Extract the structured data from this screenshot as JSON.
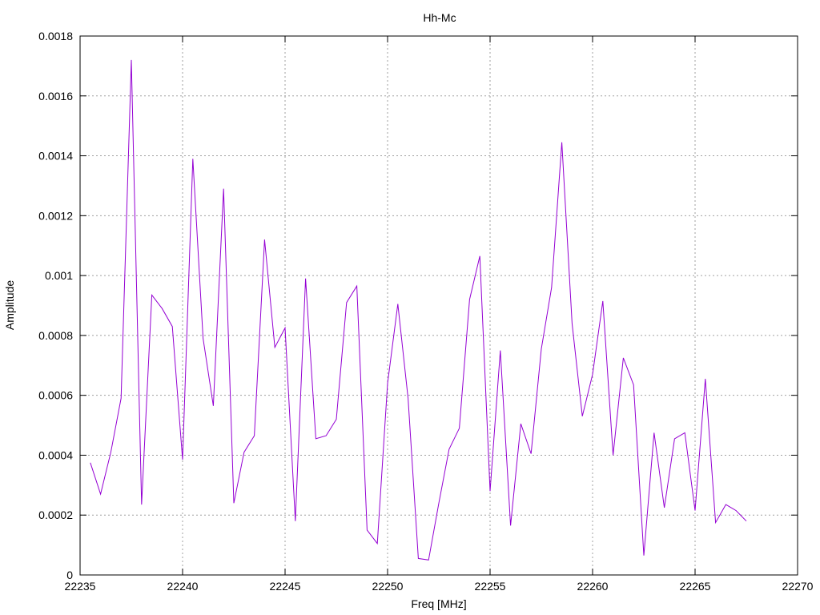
{
  "chart_data": {
    "type": "line",
    "title": "Hh-Mc",
    "xlabel": "Freq [MHz]",
    "ylabel": "Amplitude",
    "xlim": [
      22235,
      22270
    ],
    "ylim": [
      0,
      0.0018
    ],
    "grid": true,
    "xticks": [
      22235,
      22240,
      22245,
      22250,
      22255,
      22260,
      22265,
      22270
    ],
    "xtick_labels": [
      "22235",
      "22240",
      "22245",
      "22250",
      "22255",
      "22260",
      "22265",
      "22270"
    ],
    "yticks": [
      0,
      0.0002,
      0.0004,
      0.0006,
      0.0008,
      0.001,
      0.0012,
      0.0014,
      0.0016,
      0.0018
    ],
    "ytick_labels": [
      "0",
      "0.0002",
      "0.0004",
      "0.0006",
      "0.0008",
      "0.001",
      "0.0012",
      "0.0014",
      "0.0016",
      "0.0018"
    ],
    "line_color": "#9400d3",
    "series": [
      {
        "x": [
          22235.5,
          22236.0,
          22236.5,
          22237.0,
          22237.5,
          22238.0,
          22238.5,
          22239.0,
          22239.5,
          22240.0,
          22240.5,
          22241.0,
          22241.5,
          22242.0,
          22242.5,
          22243.0,
          22243.5,
          22244.0,
          22244.5,
          22245.0,
          22245.5,
          22246.0,
          22246.5,
          22247.0,
          22247.5,
          22248.0,
          22248.5,
          22249.0,
          22249.5,
          22250.0,
          22250.5,
          22251.0,
          22251.5,
          22252.0,
          22252.5,
          22253.0,
          22253.5,
          22254.0,
          22254.5,
          22255.0,
          22255.5,
          22256.0,
          22256.5,
          22257.0,
          22257.5,
          22258.0,
          22258.5,
          22259.0,
          22259.5,
          22260.0,
          22260.5,
          22261.0,
          22261.5,
          22262.0,
          22262.5,
          22263.0,
          22263.5,
          22264.0,
          22264.5,
          22265.0,
          22265.5,
          22266.0,
          22266.5,
          22267.0,
          22267.5
        ],
        "y": [
          0.000375,
          0.00027,
          0.00041,
          0.00059,
          0.00172,
          0.000235,
          0.000935,
          0.00089,
          0.00083,
          0.000385,
          0.00139,
          0.00079,
          0.000565,
          0.00129,
          0.00024,
          0.00041,
          0.000465,
          0.00112,
          0.00076,
          0.000825,
          0.00018,
          0.00099,
          0.000455,
          0.000465,
          0.00052,
          0.00091,
          0.000965,
          0.00015,
          0.000105,
          0.00064,
          0.000905,
          0.00059,
          5.5e-05,
          5e-05,
          0.00024,
          0.00042,
          0.00049,
          0.00092,
          0.001065,
          0.00028,
          0.00075,
          0.000165,
          0.000505,
          0.000405,
          0.000755,
          0.00096,
          0.001445,
          0.00084,
          0.00053,
          0.00067,
          0.000915,
          0.0004,
          0.000725,
          0.000635,
          6.5e-05,
          0.000475,
          0.000225,
          0.000455,
          0.000475,
          0.000215,
          0.000655,
          0.000175,
          0.000235,
          0.000215,
          0.00018
        ]
      }
    ]
  }
}
